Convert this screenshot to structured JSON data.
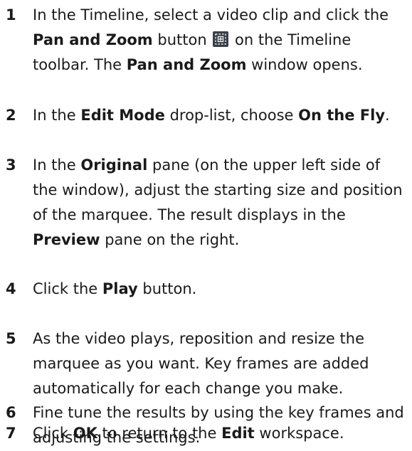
{
  "steps": [
    {
      "number": "1",
      "line1": "In the Timeline, select a video clip and click the",
      "pan_zoom": "Pan and Zoom",
      "button_word": "button",
      "on_the_timeline": "on the Timeline",
      "toolbar": "toolbar. The",
      "window_opens": "window opens.",
      "icon": "pan-zoom-icon"
    },
    {
      "number": "2",
      "in_the": "In the",
      "edit_mode": "Edit Mode",
      "drop_list": "drop-list, choose",
      "on_the_fly": "On the Fly",
      "period": "."
    },
    {
      "number": "3",
      "in_the": "In the",
      "original": "Original",
      "rest1": "pane (on the upper left side of the window), adjust the starting size and position of the marquee. The result displays in the",
      "preview": "Preview",
      "rest2": "pane on the right."
    },
    {
      "number": "4",
      "click_the": "Click the",
      "play": "Play",
      "button_period": "button."
    },
    {
      "number": "5",
      "text": "As the video plays, reposition and resize the marquee as you want. Key frames are added automatically for each change you make."
    },
    {
      "number": "6",
      "text": "Fine tune the results by using the key frames and adjusting the settings."
    },
    {
      "number": "7",
      "click": "Click",
      "ok": "OK",
      "to_return": "to return to the",
      "edit": "Edit",
      "workspace": "workspace."
    }
  ]
}
